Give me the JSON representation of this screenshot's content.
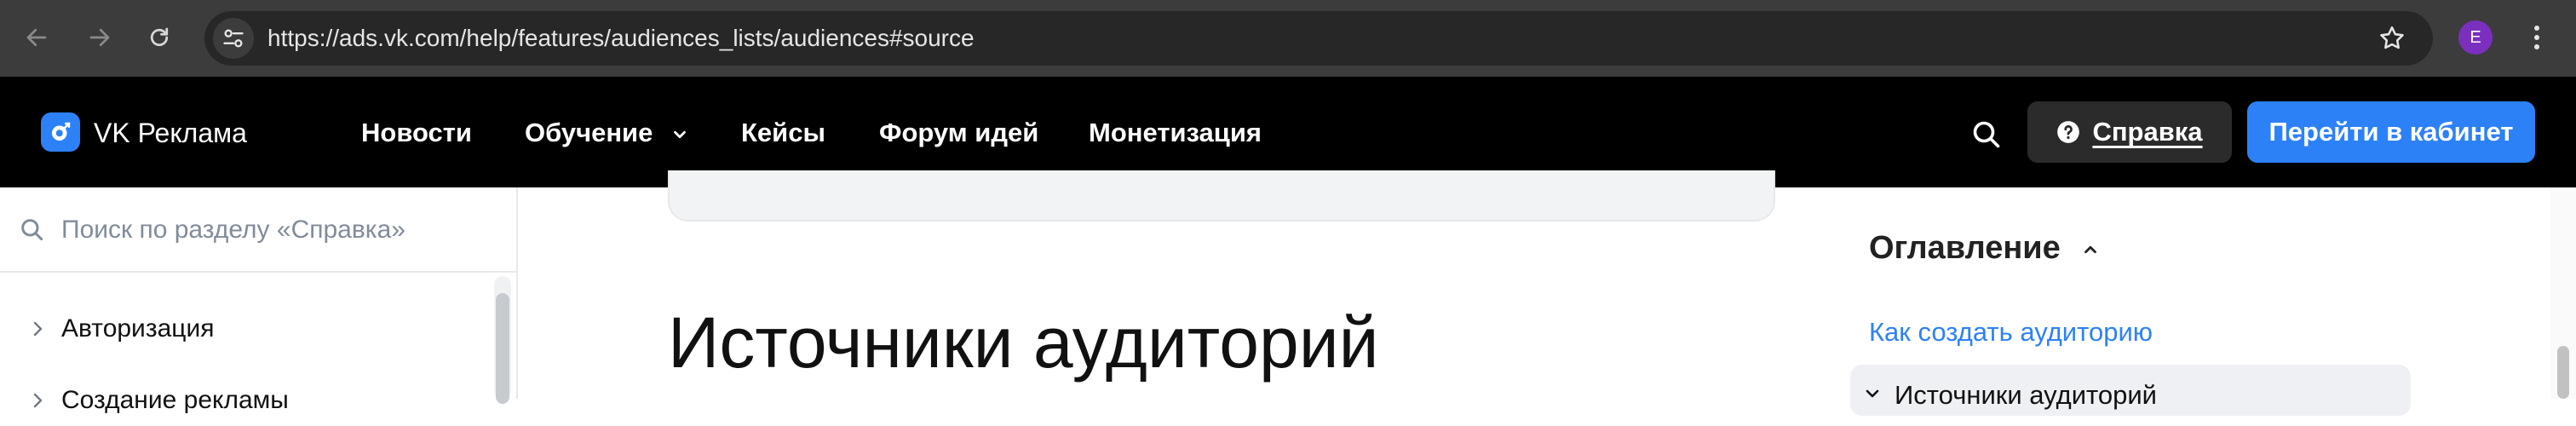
{
  "browser": {
    "url": "https://ads.vk.com/help/features/audiences_lists/audiences#source",
    "profile_initial": "E"
  },
  "header": {
    "logo_text": "VK Реклама",
    "nav": [
      {
        "label": "Новости"
      },
      {
        "label": "Обучение",
        "has_dropdown": true
      },
      {
        "label": "Кейсы"
      },
      {
        "label": "Форум идей"
      },
      {
        "label": "Монетизация"
      }
    ],
    "help_label": "Справка",
    "cabinet_label": "Перейти в кабинет"
  },
  "sidebar": {
    "search_placeholder": "Поиск по разделу «Справка»",
    "items": [
      {
        "label": "Авторизация"
      },
      {
        "label": "Создание рекламы"
      }
    ]
  },
  "main": {
    "title": "Источники аудиторий"
  },
  "toc": {
    "title": "Оглавление",
    "items": [
      {
        "label": "Как создать аудиторию",
        "active": false
      },
      {
        "label": "Источники аудиторий",
        "active": true
      }
    ]
  },
  "colors": {
    "accent": "#2d81f7",
    "header_bg": "#000000",
    "browser_bg": "#3c3c3c",
    "avatar": "#7b2fbe"
  },
  "icons": [
    "back-arrow-icon",
    "forward-arrow-icon",
    "reload-icon",
    "site-info-icon",
    "star-icon",
    "kebab-menu-icon",
    "vk-logo-icon",
    "chevron-down-icon",
    "search-icon",
    "question-circle-icon",
    "chevron-right-icon",
    "chevron-up-icon"
  ]
}
